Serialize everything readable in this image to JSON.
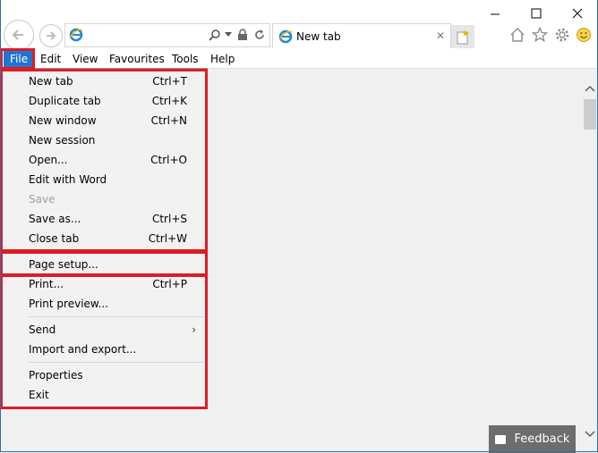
{
  "window": {
    "minimize": "—",
    "maximize": "☐",
    "close": "✕"
  },
  "tab": {
    "label": "New tab",
    "close": "✕"
  },
  "menubar": {
    "items": [
      {
        "label": "File",
        "active": true
      },
      {
        "label": "Edit"
      },
      {
        "label": "View"
      },
      {
        "label": "Favourites"
      },
      {
        "label": "Tools"
      },
      {
        "label": "Help"
      }
    ]
  },
  "file_menu": {
    "items": [
      {
        "label": "New tab",
        "shortcut": "Ctrl+T"
      },
      {
        "label": "Duplicate tab",
        "shortcut": "Ctrl+K"
      },
      {
        "label": "New window",
        "shortcut": "Ctrl+N"
      },
      {
        "label": "New session",
        "shortcut": ""
      },
      {
        "label": "Open...",
        "shortcut": "Ctrl+O"
      },
      {
        "label": "Edit with Word",
        "shortcut": ""
      },
      {
        "label": "Save",
        "shortcut": "",
        "disabled": true
      },
      {
        "label": "Save as...",
        "shortcut": "Ctrl+S"
      },
      {
        "label": "Close tab",
        "shortcut": "Ctrl+W"
      },
      {
        "label": "Page setup...",
        "shortcut": ""
      },
      {
        "label": "Print...",
        "shortcut": "Ctrl+P"
      },
      {
        "label": "Print preview...",
        "shortcut": ""
      },
      {
        "label": "Send",
        "shortcut": "",
        "submenu": true
      },
      {
        "label": "Import and export...",
        "shortcut": ""
      },
      {
        "label": "Properties",
        "shortcut": ""
      },
      {
        "label": "Exit",
        "shortcut": ""
      }
    ]
  },
  "feedback": {
    "label": "Feedback"
  },
  "icons": {
    "back": "back-icon",
    "forward": "forward-icon",
    "ie": "internet-explorer-icon",
    "search": "search-icon",
    "lock": "lock-icon",
    "refresh": "refresh-icon",
    "home": "home-icon",
    "favorites": "star-icon",
    "settings": "gear-icon",
    "smiley": "smiley-icon"
  },
  "colors": {
    "highlight": "#e01b24",
    "menu_active": "#1f76d2",
    "feedback_bg": "#6d6d6d"
  }
}
